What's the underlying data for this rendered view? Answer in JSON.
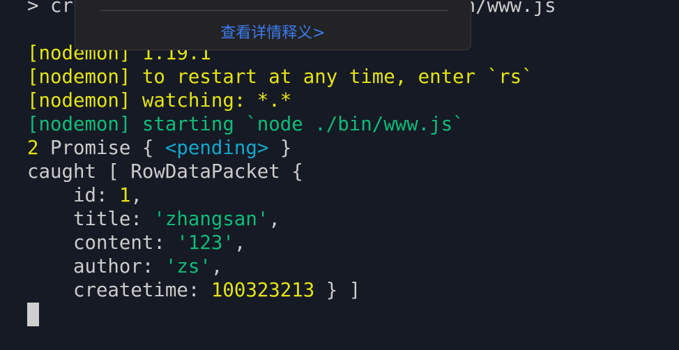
{
  "colors": {
    "background": "#161a25",
    "default": "#cccccc",
    "yellow": "#e5e510",
    "green": "#0dbc79",
    "cyan": "#11a8cd",
    "link": "#3b7cf0"
  },
  "terminal": {
    "lines": [
      [
        {
          "t": "> cr                                  n/www.js",
          "c": "default"
        }
      ],
      [],
      [
        {
          "t": "[nodemon] 1.19.1",
          "c": "yellow"
        }
      ],
      [
        {
          "t": "[nodemon] to restart at any time, enter `rs`",
          "c": "yellow"
        }
      ],
      [
        {
          "t": "[nodemon] watching: *.*",
          "c": "yellow"
        }
      ],
      [
        {
          "t": "[nodemon] starting `node ./bin/www.js`",
          "c": "green"
        }
      ],
      [
        {
          "t": "2",
          "c": "yellow"
        },
        {
          "t": " Promise { ",
          "c": "default"
        },
        {
          "t": "<pending>",
          "c": "cyan"
        },
        {
          "t": " }",
          "c": "default"
        }
      ],
      [
        {
          "t": "caught [ RowDataPacket {",
          "c": "default"
        }
      ],
      [
        {
          "t": "    id: ",
          "c": "default"
        },
        {
          "t": "1",
          "c": "yellow"
        },
        {
          "t": ",",
          "c": "default"
        }
      ],
      [
        {
          "t": "    title: ",
          "c": "default"
        },
        {
          "t": "'zhangsan'",
          "c": "green"
        },
        {
          "t": ",",
          "c": "default"
        }
      ],
      [
        {
          "t": "    content: ",
          "c": "default"
        },
        {
          "t": "'123'",
          "c": "green"
        },
        {
          "t": ",",
          "c": "default"
        }
      ],
      [
        {
          "t": "    author: ",
          "c": "default"
        },
        {
          "t": "'zs'",
          "c": "green"
        },
        {
          "t": ",",
          "c": "default"
        }
      ],
      [
        {
          "t": "    createtime: ",
          "c": "default"
        },
        {
          "t": "100323213",
          "c": "yellow"
        },
        {
          "t": " } ]",
          "c": "default"
        }
      ]
    ]
  },
  "popup": {
    "link_label": "查看详情释义>"
  }
}
